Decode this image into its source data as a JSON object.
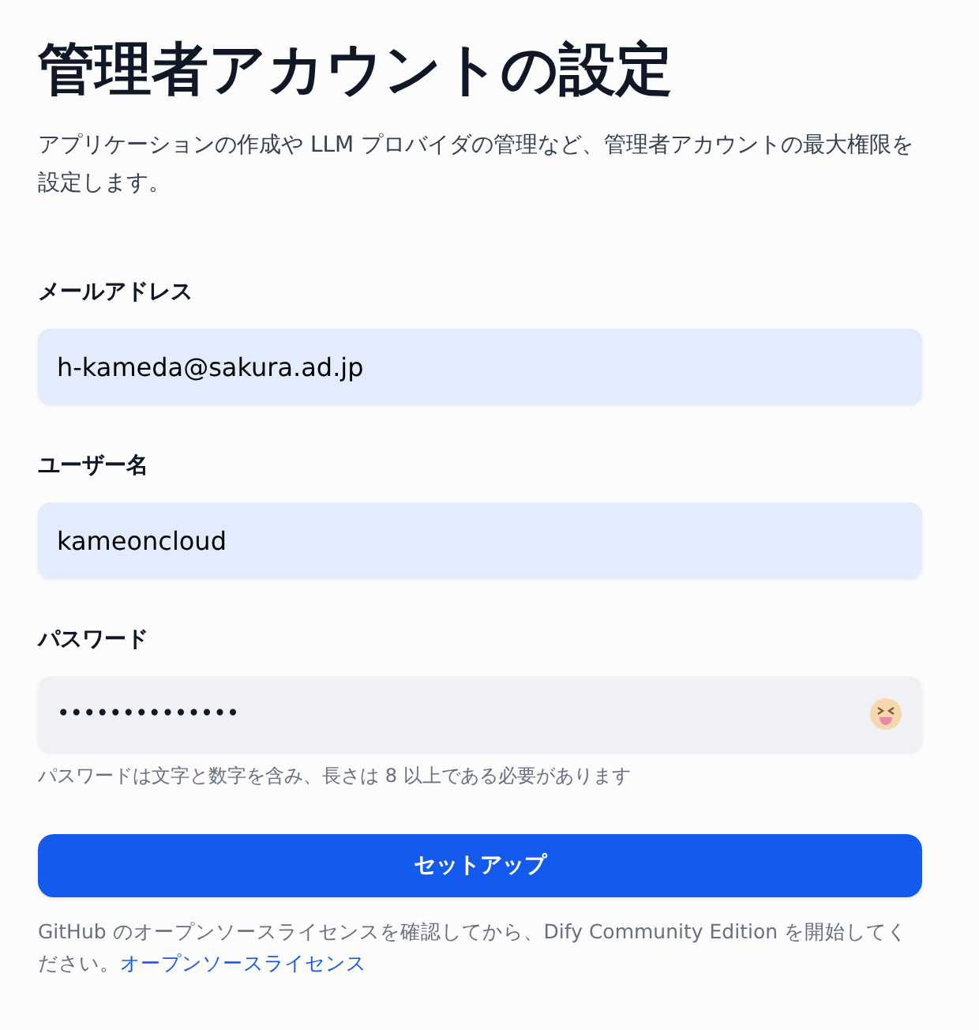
{
  "title": "管理者アカウントの設定",
  "subtitle": "アプリケーションの作成や LLM プロバイダの管理など、管理者アカウントの最大権限を設定します。",
  "fields": [
    {
      "kind": "text",
      "label": "メールアドレス",
      "value": "h-kameda@sakura.ad.jp",
      "autofilled": true
    },
    {
      "kind": "text",
      "label": "ユーザー名",
      "value": "kameoncloud",
      "autofilled": true
    },
    {
      "kind": "password",
      "label": "パスワード",
      "value": "••••••••••••••",
      "autofilled": false,
      "hint": "パスワードは文字と数字を含み、長さは 8 以上である必要があります"
    }
  ],
  "submit_button": "セットアップ",
  "notice": {
    "text": "GitHub のオープンソースライセンスを確認してから、Dify Community Edition を開始してください。",
    "link": "オープンソースライセンス"
  }
}
